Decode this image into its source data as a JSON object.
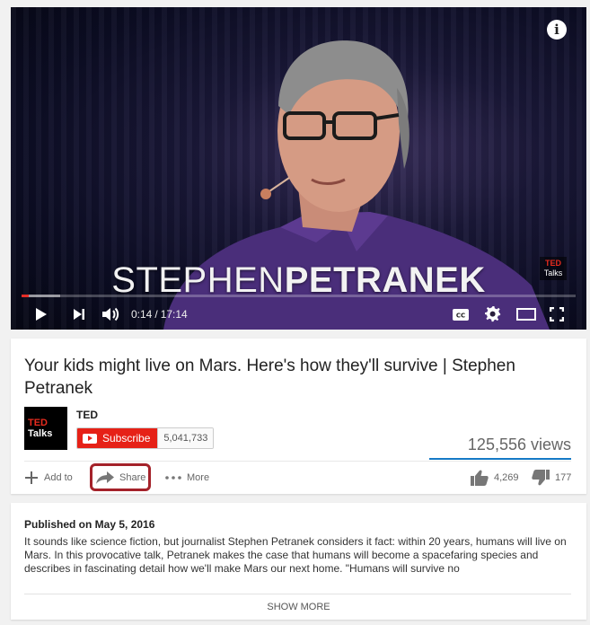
{
  "player": {
    "overlay_first_name": "STEPHEN",
    "overlay_last_name": "PETRANEK",
    "watermark_top": "TED",
    "watermark_bottom": "Talks",
    "info_icon": "i",
    "current_time": "0:14",
    "separator": "/",
    "duration": "17:14",
    "progress_fraction": 0.0135,
    "cc_label": "CC"
  },
  "video": {
    "title": "Your kids might live on Mars. Here's how they'll survive | Stephen Petranek"
  },
  "channel": {
    "logo_top": "TED",
    "logo_bottom": "Talks",
    "name": "TED",
    "subscribe_label": "Subscribe",
    "subscriber_count": "5,041,733"
  },
  "stats": {
    "views": "125,556 views",
    "likes": "4,269",
    "dislikes": "177"
  },
  "actions": {
    "add_to": "Add to",
    "share": "Share",
    "more": "More"
  },
  "description": {
    "published": "Published on May 5, 2016",
    "text": "It sounds like science fiction, but journalist Stephen Petranek considers it fact: within 20 years, humans will live on Mars. In this provocative talk, Petranek makes the case that humans will become a spacefaring species and describes in fascinating detail how we'll make Mars our next home. \"Humans will survive no",
    "show_more": "SHOW MORE"
  },
  "colors": {
    "accent_red": "#e62117",
    "view_bar_blue": "#167ac6",
    "highlight_border": "#a4222a"
  }
}
